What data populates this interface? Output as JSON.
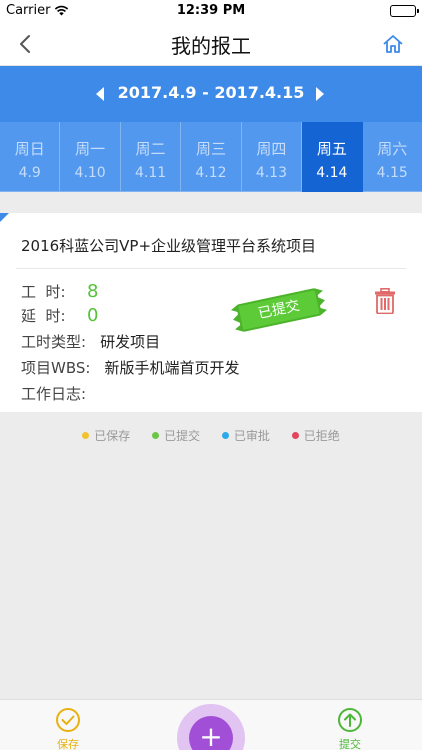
{
  "status_bar": {
    "carrier": "Carrier",
    "time": "12:39 PM"
  },
  "nav": {
    "title": "我的报工",
    "back_icon": "chevron-left-icon",
    "home_icon": "home-icon"
  },
  "week": {
    "range": "2017.4.9 - 2017.4.15"
  },
  "days": [
    {
      "name": "周日",
      "date": "4.9"
    },
    {
      "name": "周一",
      "date": "4.10"
    },
    {
      "name": "周二",
      "date": "4.11"
    },
    {
      "name": "周三",
      "date": "4.12"
    },
    {
      "name": "周四",
      "date": "4.13"
    },
    {
      "name": "周五",
      "date": "4.14"
    },
    {
      "name": "周六",
      "date": "4.15"
    }
  ],
  "active_day_index": 5,
  "entry": {
    "project": "2016科蓝公司VP+企业级管理平台系统项目",
    "hours_label": "工  时:",
    "hours_value": "8",
    "overtime_label": "延  时:",
    "overtime_value": "0",
    "type_label": "工时类型:",
    "type_value": "研发项目",
    "wbs_label": "项目WBS:",
    "wbs_value": "新版手机端首页开发",
    "log_label": "工作日志:",
    "log_value": "",
    "stamp": "已提交"
  },
  "legend": [
    {
      "label": "已保存",
      "color": "#f2c12e"
    },
    {
      "label": "已提交",
      "color": "#6cc644"
    },
    {
      "label": "已审批",
      "color": "#2ea8e6"
    },
    {
      "label": "已拒绝",
      "color": "#e2455c"
    }
  ],
  "colors": {
    "primary": "#3d8ae8",
    "active_day": "#1464d4",
    "green": "#55c23a",
    "red": "#e06a6a",
    "purple": "#a14fd6"
  },
  "tabs": {
    "save_label": "保存",
    "submit_label": "提交",
    "add_label": "+"
  }
}
